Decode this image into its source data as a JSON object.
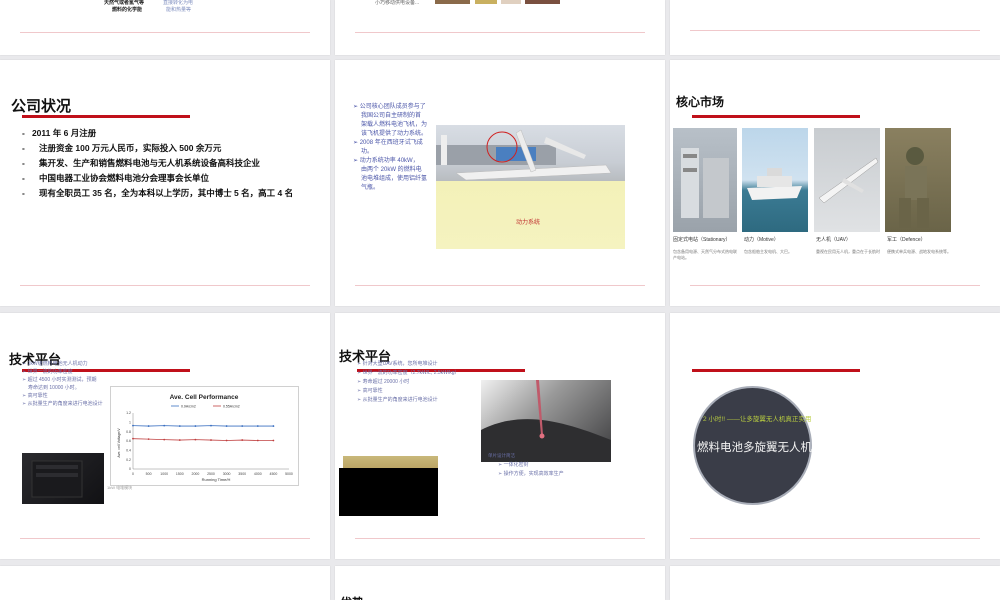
{
  "top_row": {
    "s1_text1": "天然气或者氢气等",
    "s1_text2": "燃料的化学能",
    "s1_text3": "直接转化为电",
    "s1_text4": "能和热量等",
    "s2_text": "小巧移动供电设备..."
  },
  "company": {
    "title": "公司状况",
    "items": [
      {
        "dash": "-",
        "text": "2011 年 6 月注册"
      },
      {
        "dash": "-",
        "text": "注册资金 100 万元人民币，实际投入 500 余万元"
      },
      {
        "dash": "-",
        "text": "集开发、生产和销售燃料电池与无人机系统设备高科技企业"
      },
      {
        "dash": "-",
        "text": "中国电器工业协会燃料电池分会理事会长单位"
      },
      {
        "dash": "-",
        "text": "现有全职员工 35 名，全为本科以上学历，其中博士 5 名，高工 4 名"
      }
    ]
  },
  "aircraft": {
    "bullets": [
      "公司核心团队成员参与了",
      "我国公司自主研制的首",
      "架载人燃料电池飞机，为",
      "该飞机提供了动力系统。",
      "2008 年在西班牙试飞成",
      "功。",
      "动力系统功率 40kW，",
      "由两个 20kW 的燃料电",
      "池电堆组成，使用铝纤氢",
      "气瓶。"
    ],
    "label": "动力系统"
  },
  "market": {
    "title": "核心市场",
    "cards": [
      {
        "name": "固定式电站（Stationary）",
        "desc": "包含备用电源、天然气分布式热电联产电站。"
      },
      {
        "name": "动力（Motive）",
        "desc": "包含船舶主发电机、大巴。"
      },
      {
        "name": "无人机（UAV）",
        "desc": "重视在民用无人机，重点在于长航时"
      },
      {
        "name": "军工（Defence）",
        "desc": "便携式单兵电源、战地发电系统等。"
      }
    ]
  },
  "tech1": {
    "title": "技术平台",
    "bullets": [
      "1kW级燃料电池无人机动力",
      "世界一流的功率密度",
      "超过 4500 小时实测测试，预期",
      "寿命达到 10000 小时。",
      "高可靠性",
      "从批量生产的角度来进行电池设计"
    ],
    "caption": "1kW 电堆模块",
    "chart_data": {
      "type": "line",
      "title": "Ave. Cell Performance",
      "xlabel": "Running Time/H",
      "ylabel": "Ave. cell Voltage/V",
      "x_ticks": [
        "0",
        "500",
        "1000",
        "1500",
        "2000",
        "2500",
        "3000",
        "3500",
        "4000",
        "4500",
        "5000"
      ],
      "y_ticks": [
        "0",
        "0.2",
        "0.4",
        "0.6",
        "0.8",
        "1",
        "1.2"
      ],
      "xlim": [
        0,
        5000
      ],
      "ylim": [
        0,
        1.2
      ],
      "series": [
        {
          "name": "0.9A/cm2",
          "color": "#3a6fc0",
          "x": [
            0,
            500,
            1000,
            1500,
            2000,
            2500,
            3000,
            3500,
            4000,
            4500
          ],
          "values": [
            0.93,
            0.92,
            0.93,
            0.92,
            0.92,
            0.93,
            0.92,
            0.92,
            0.92,
            0.92
          ]
        },
        {
          "name": "0.55A/cm2",
          "color": "#c04040",
          "x": [
            0,
            500,
            1000,
            1500,
            2000,
            2500,
            3000,
            3500,
            4000,
            4500
          ],
          "values": [
            0.65,
            0.64,
            0.63,
            0.62,
            0.63,
            0.62,
            0.61,
            0.62,
            0.61,
            0.61
          ]
        }
      ]
    }
  },
  "tech2": {
    "title": "技术平台",
    "bullets": [
      "针对大型UAV系统，您所电堆设计",
      "世界一流的功率密度（2.7kW/L, 2.5kW/kg）",
      "寿命超过 20000 小时",
      "高可靠性",
      "从批量生产的角度来进行电池设计"
    ],
    "bullets2": [
      "一体化密封",
      "操作方便，实现高效率生产"
    ],
    "label_left": "单片设计简洁"
  },
  "uav": {
    "subtitle": "2 小时!! ——让多旋翼无人机真正实用",
    "title": "燃料电池多旋翼无人机"
  },
  "bottom_row": {
    "title": "优势"
  },
  "colors": {
    "accent_red": "#c0101a",
    "link_blue": "#4a55a8",
    "circle": "#3a3d48"
  }
}
